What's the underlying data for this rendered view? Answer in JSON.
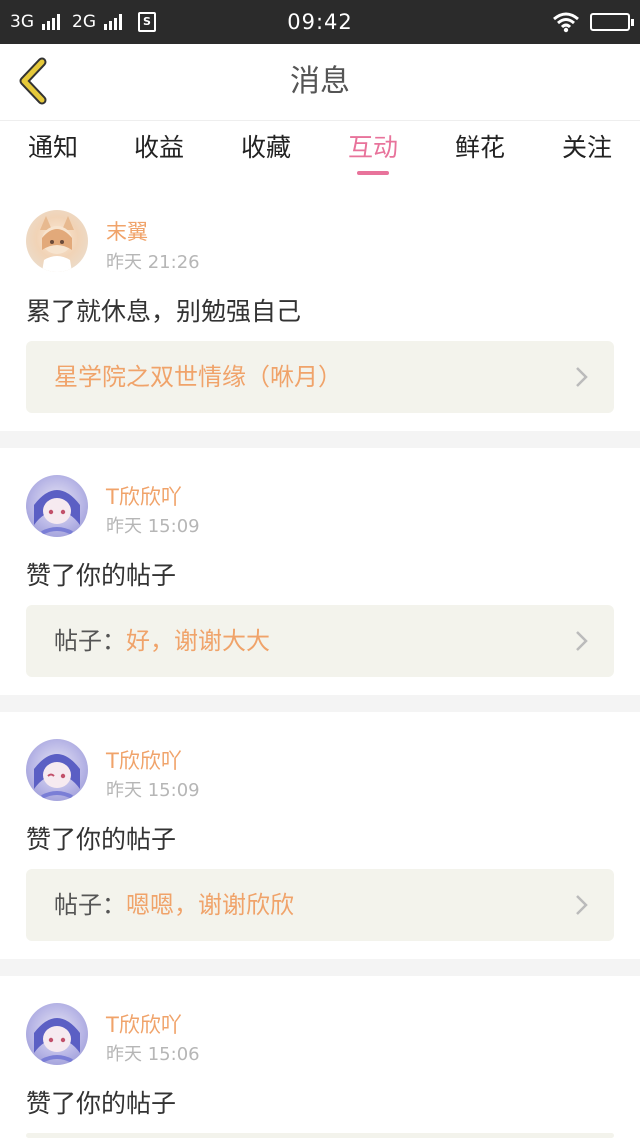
{
  "status_bar": {
    "net1": "3G",
    "net2": "2G",
    "time": "09:42",
    "icons": [
      "signal-icon",
      "sim-icon",
      "wifi-icon",
      "battery-icon"
    ]
  },
  "header": {
    "title": "消息",
    "back_icon": "chevron-left-icon"
  },
  "tabs": [
    {
      "label": "通知"
    },
    {
      "label": "收益"
    },
    {
      "label": "收藏"
    },
    {
      "label": "互动",
      "active": true
    },
    {
      "label": "鲜花"
    },
    {
      "label": "关注"
    }
  ],
  "messages": [
    {
      "user": "末翼",
      "time": "昨天 21:26",
      "text": "累了就休息，别勉强自己",
      "ref_prefix": "",
      "ref_value": "星学院之双世情缘（咻月）"
    },
    {
      "user": "T欣欣吖",
      "time": "昨天 15:09",
      "text": "赞了你的帖子",
      "ref_prefix": "帖子：",
      "ref_value": "好，谢谢大大"
    },
    {
      "user": "T欣欣吖",
      "time": "昨天 15:09",
      "text": "赞了你的帖子",
      "ref_prefix": "帖子：",
      "ref_value": "嗯嗯，谢谢欣欣"
    },
    {
      "user": "T欣欣吖",
      "time": "昨天 15:06",
      "text": "赞了你的帖子",
      "ref_prefix": "",
      "ref_value": ""
    }
  ],
  "colors": {
    "accent": "#e8739b",
    "username": "#f0a36a",
    "back_arrow": "#e6c93a"
  }
}
